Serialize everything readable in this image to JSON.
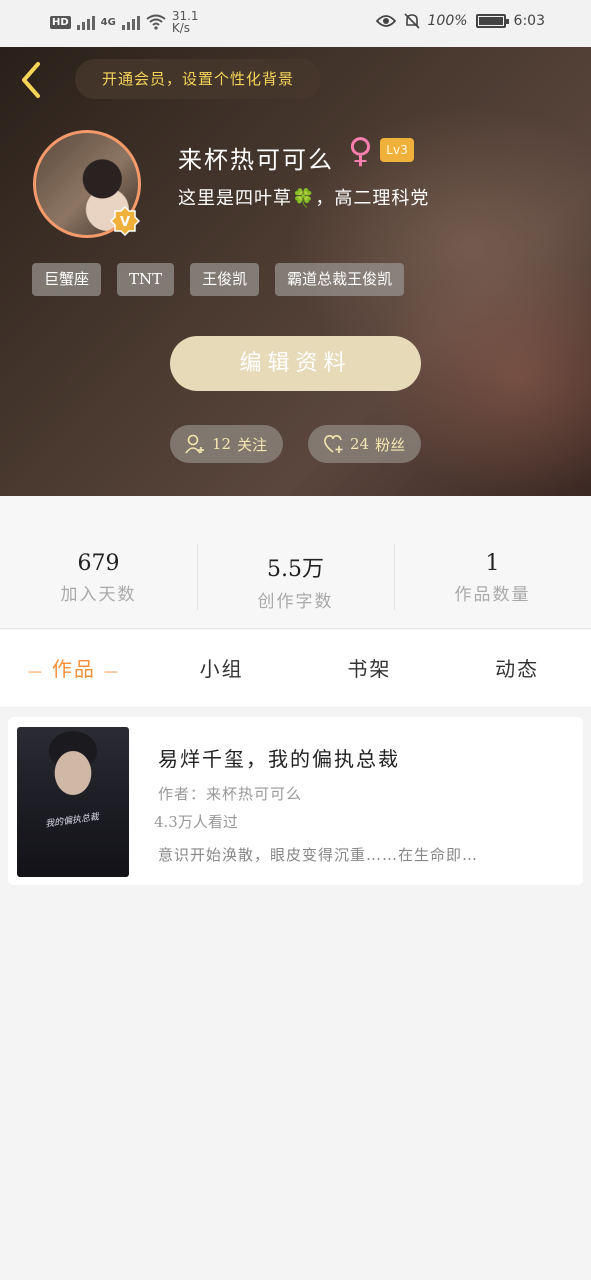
{
  "status_bar": {
    "hd_label": "HD",
    "network_type": "4G",
    "speed_value": "31.1",
    "speed_unit": "K/s",
    "battery_percent": "100%",
    "time": "6:03"
  },
  "header": {
    "vip_banner": "开通会员，设置个性化背景",
    "username": "来杯热可可么",
    "gender_symbol": "♀",
    "level": "Lv3",
    "bio": "这里是四叶草🍀，高二理科党",
    "tags": [
      "巨蟹座",
      "TNT",
      "王俊凯",
      "霸道总裁王俊凯"
    ],
    "edit_button": "编辑资料",
    "follow": {
      "count": "12",
      "label": "关注"
    },
    "fans": {
      "count": "24",
      "label": "粉丝"
    }
  },
  "stats": [
    {
      "value": "679",
      "label": "加入天数"
    },
    {
      "value": "5.5万",
      "label": "创作字数"
    },
    {
      "value": "1",
      "label": "作品数量"
    }
  ],
  "tabs": [
    "作品",
    "小组",
    "书架",
    "动态"
  ],
  "work": {
    "title": "易烊千玺，我的偏执总裁",
    "author": "作者：来杯热可可么",
    "views": "4.3万人看过",
    "summary": "意识开始涣散，眼皮变得沉重……在生命即…",
    "cover_text": "我的偏执总裁"
  },
  "colors": {
    "accent": "#f5903a",
    "vip_text": "#f5d45a",
    "level_badge": "#f0b13a",
    "gender": "#ff7fb0",
    "edit_button_bg": "#e6dab8"
  }
}
